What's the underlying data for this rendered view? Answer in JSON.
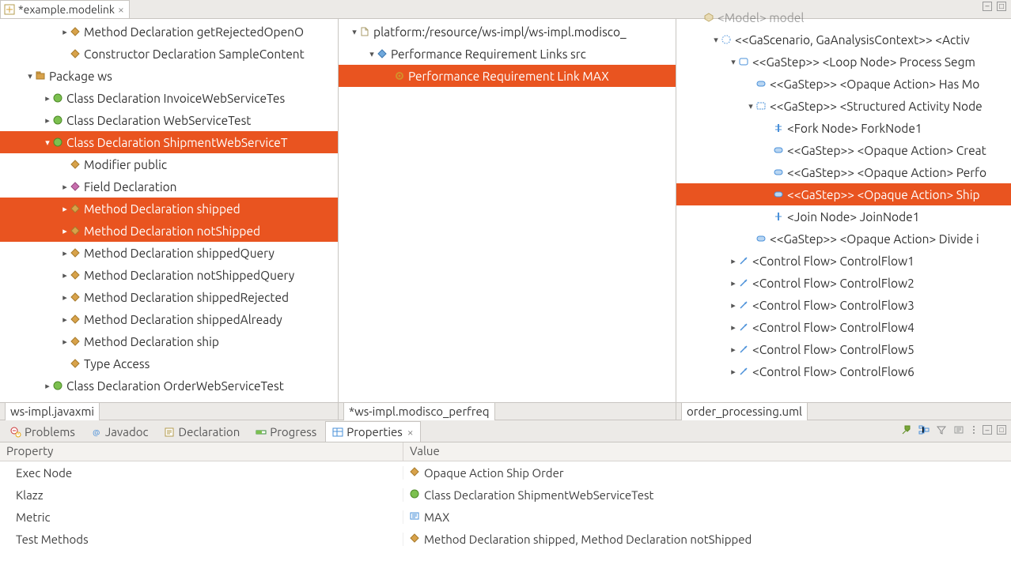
{
  "colors": {
    "selection": "#e95420"
  },
  "editorTab": {
    "title": "*example.modelink"
  },
  "leftPane": {
    "tab": "ws-impl.javaxmi",
    "rows": [
      {
        "indent": 3,
        "twisty": "collapsed",
        "icon": "method",
        "label": "Method Declaration getRejectedOpenO",
        "sel": false
      },
      {
        "indent": 3,
        "twisty": "",
        "icon": "method",
        "label": "Constructor Declaration SampleContent",
        "sel": false
      },
      {
        "indent": 1,
        "twisty": "expanded",
        "icon": "package",
        "label": "Package ws",
        "sel": false
      },
      {
        "indent": 2,
        "twisty": "collapsed",
        "icon": "class",
        "label": "Class Declaration InvoiceWebServiceTes",
        "sel": false
      },
      {
        "indent": 2,
        "twisty": "collapsed",
        "icon": "class",
        "label": "Class Declaration WebServiceTest",
        "sel": false
      },
      {
        "indent": 2,
        "twisty": "expanded",
        "icon": "class",
        "label": "Class Declaration ShipmentWebServiceT",
        "sel": true
      },
      {
        "indent": 3,
        "twisty": "",
        "icon": "method",
        "label": "Modifier public",
        "sel": false
      },
      {
        "indent": 3,
        "twisty": "collapsed",
        "icon": "field",
        "label": "Field Declaration",
        "sel": false
      },
      {
        "indent": 3,
        "twisty": "collapsed",
        "icon": "method",
        "label": "Method Declaration shipped",
        "sel": true
      },
      {
        "indent": 3,
        "twisty": "collapsed",
        "icon": "method",
        "label": "Method Declaration notShipped",
        "sel": true
      },
      {
        "indent": 3,
        "twisty": "collapsed",
        "icon": "method",
        "label": "Method Declaration shippedQuery",
        "sel": false
      },
      {
        "indent": 3,
        "twisty": "collapsed",
        "icon": "method",
        "label": "Method Declaration notShippedQuery",
        "sel": false
      },
      {
        "indent": 3,
        "twisty": "collapsed",
        "icon": "method",
        "label": "Method Declaration shippedRejected",
        "sel": false
      },
      {
        "indent": 3,
        "twisty": "collapsed",
        "icon": "method",
        "label": "Method Declaration shippedAlready",
        "sel": false
      },
      {
        "indent": 3,
        "twisty": "collapsed",
        "icon": "method",
        "label": "Method Declaration ship",
        "sel": false
      },
      {
        "indent": 3,
        "twisty": "",
        "icon": "method",
        "label": "Type Access",
        "sel": false
      },
      {
        "indent": 2,
        "twisty": "collapsed",
        "icon": "class",
        "label": "Class Declaration OrderWebServiceTest",
        "sel": false
      }
    ]
  },
  "middlePane": {
    "tab": "*ws-impl.modisco_perfreq",
    "rows": [
      {
        "indent": 0,
        "twisty": "expanded",
        "icon": "file",
        "label": "platform:/resource/ws-impl/ws-impl.modisco_",
        "sel": false
      },
      {
        "indent": 1,
        "twisty": "expanded",
        "icon": "links",
        "label": "Performance Requirement Links src",
        "sel": false
      },
      {
        "indent": 2,
        "twisty": "",
        "icon": "link",
        "label": "Performance Requirement Link MAX",
        "sel": true
      }
    ]
  },
  "rightPane": {
    "tab": "order_processing.uml",
    "rows": [
      {
        "indent": 1,
        "twisty": "",
        "icon": "model",
        "label": "<Model> model",
        "sel": false,
        "cut": true
      },
      {
        "indent": 2,
        "twisty": "expanded",
        "icon": "stereo",
        "label": "<<GaScenario, GaAnalysisContext>> <Activ",
        "sel": false
      },
      {
        "indent": 3,
        "twisty": "expanded",
        "icon": "step",
        "label": "<<GaStep>> <Loop Node> Process Segm",
        "sel": false
      },
      {
        "indent": 4,
        "twisty": "",
        "icon": "action",
        "label": "<<GaStep>> <Opaque Action> Has Mo",
        "sel": false
      },
      {
        "indent": 4,
        "twisty": "expanded",
        "icon": "struct",
        "label": "<<GaStep>> <Structured Activity Node",
        "sel": false
      },
      {
        "indent": 5,
        "twisty": "",
        "icon": "fork",
        "label": "<Fork Node> ForkNode1",
        "sel": false
      },
      {
        "indent": 5,
        "twisty": "",
        "icon": "action",
        "label": "<<GaStep>> <Opaque Action> Creat",
        "sel": false
      },
      {
        "indent": 5,
        "twisty": "",
        "icon": "action",
        "label": "<<GaStep>> <Opaque Action> Perfo",
        "sel": false
      },
      {
        "indent": 5,
        "twisty": "",
        "icon": "action",
        "label": "<<GaStep>> <Opaque Action> Ship",
        "sel": true
      },
      {
        "indent": 5,
        "twisty": "",
        "icon": "join",
        "label": "<Join Node> JoinNode1",
        "sel": false
      },
      {
        "indent": 4,
        "twisty": "",
        "icon": "action",
        "label": "<<GaStep>> <Opaque Action> Divide i",
        "sel": false
      },
      {
        "indent": 3,
        "twisty": "collapsed",
        "icon": "flow",
        "label": "<Control Flow> ControlFlow1",
        "sel": false
      },
      {
        "indent": 3,
        "twisty": "collapsed",
        "icon": "flow",
        "label": "<Control Flow> ControlFlow2",
        "sel": false
      },
      {
        "indent": 3,
        "twisty": "collapsed",
        "icon": "flow",
        "label": "<Control Flow> ControlFlow3",
        "sel": false
      },
      {
        "indent": 3,
        "twisty": "collapsed",
        "icon": "flow",
        "label": "<Control Flow> ControlFlow4",
        "sel": false
      },
      {
        "indent": 3,
        "twisty": "collapsed",
        "icon": "flow",
        "label": "<Control Flow> ControlFlow5",
        "sel": false
      },
      {
        "indent": 3,
        "twisty": "collapsed",
        "icon": "flow",
        "label": "<Control Flow> ControlFlow6",
        "sel": false
      }
    ]
  },
  "bottom": {
    "tabs": [
      {
        "label": "Problems",
        "icon": "problems",
        "active": false
      },
      {
        "label": "Javadoc",
        "icon": "javadoc",
        "active": false
      },
      {
        "label": "Declaration",
        "icon": "declaration",
        "active": false
      },
      {
        "label": "Progress",
        "icon": "progress",
        "active": false
      },
      {
        "label": "Properties",
        "icon": "properties",
        "active": true,
        "closable": true
      }
    ],
    "columns": {
      "property": "Property",
      "value": "Value"
    },
    "rows": [
      {
        "key": "Exec Node",
        "icon": "method",
        "value": "Opaque Action Ship Order"
      },
      {
        "key": "Klazz",
        "icon": "class",
        "value": "Class Declaration ShipmentWebServiceTest"
      },
      {
        "key": "Metric",
        "icon": "enum",
        "value": "MAX"
      },
      {
        "key": "Test Methods",
        "icon": "method",
        "value": "Method Declaration shipped, Method Declaration notShipped"
      }
    ]
  }
}
